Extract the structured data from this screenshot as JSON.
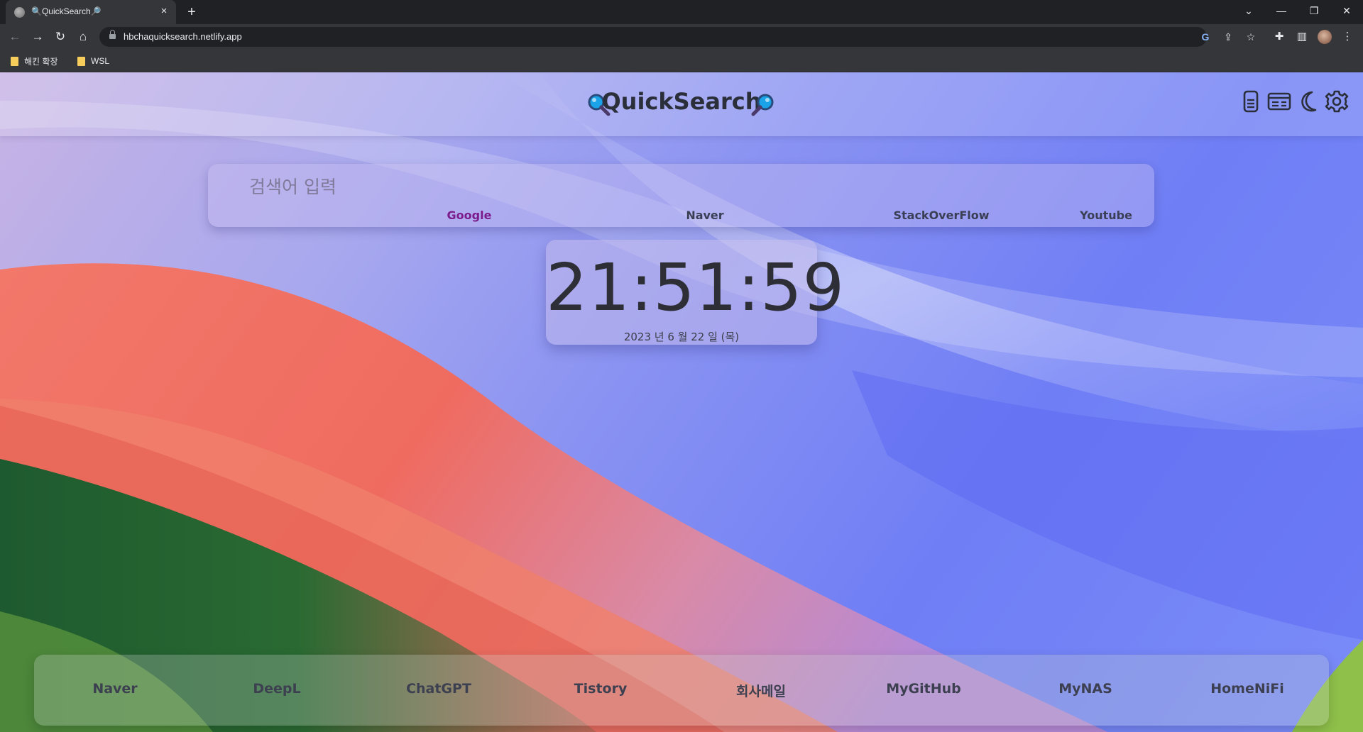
{
  "browser": {
    "tab_title": "🔍QuickSearch🔎",
    "new_tab_label": "+",
    "url": "hbchaquicksearch.netlify.app",
    "bookmarks": [
      {
        "label": "해킨 확장"
      },
      {
        "label": "WSL"
      }
    ]
  },
  "header": {
    "title": "QuickSearch",
    "left_icon": "magnifier-left-icon",
    "right_icon": "magnifier-right-icon",
    "buttons": [
      "memo-icon",
      "card-icon",
      "moon-icon",
      "gear-icon"
    ]
  },
  "search": {
    "placeholder": "검색어 입력",
    "engines": [
      {
        "label": "Google",
        "active": true
      },
      {
        "label": "Naver",
        "active": false
      },
      {
        "label": "StackOverFlow",
        "active": false
      },
      {
        "label": "Youtube",
        "active": false
      }
    ]
  },
  "clock": {
    "time": "21:51:59",
    "date": "2023 년 6 월 22 일 (목)"
  },
  "links": [
    {
      "label": "Naver"
    },
    {
      "label": "DeepL"
    },
    {
      "label": "ChatGPT"
    },
    {
      "label": "Tistory"
    },
    {
      "label": "회사메일"
    },
    {
      "label": "MyGitHub"
    },
    {
      "label": "MyNAS"
    },
    {
      "label": "HomeNiFi"
    }
  ],
  "colors": {
    "active_engine": "#7b1b8c",
    "title_text": "#2b2f3a"
  }
}
